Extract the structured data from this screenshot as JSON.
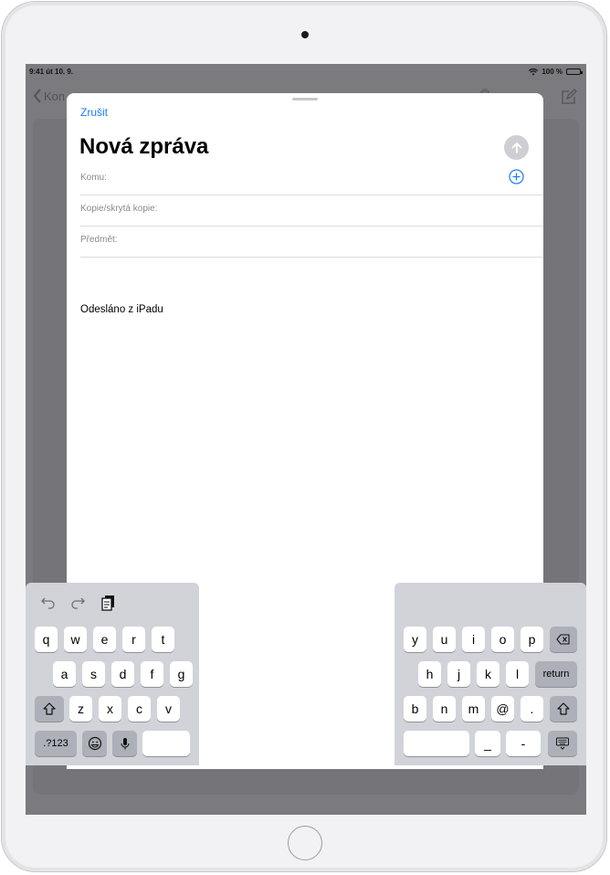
{
  "status_bar": {
    "time": "9:41 út 10. 9.",
    "battery": "100 %"
  },
  "background_mail": {
    "back_label": "Kon"
  },
  "compose": {
    "cancel_label": "Zrušit",
    "title": "Nová zpráva",
    "fields": {
      "to_label": "Komu:",
      "cc_bcc_label": "Kopie/skrytá kopie:",
      "subject_label": "Předmět:"
    },
    "signature": "Odesláno z iPadu"
  },
  "keyboard": {
    "left": {
      "row1": [
        "q",
        "w",
        "e",
        "r",
        "t"
      ],
      "row2": [
        "a",
        "s",
        "d",
        "f",
        "g"
      ],
      "row3": [
        "z",
        "x",
        "c",
        "v"
      ],
      "numbers_label": ".?123"
    },
    "right": {
      "row1": [
        "y",
        "u",
        "i",
        "o",
        "p"
      ],
      "row2": [
        "h",
        "j",
        "k",
        "l"
      ],
      "return_label": "return",
      "row3": [
        "b",
        "n",
        "m",
        "@",
        "."
      ],
      "row4": [
        "_",
        "-"
      ]
    }
  },
  "colors": {
    "accent": "#1a7cf4",
    "keyboard_bg": "#d1d3d9",
    "modifier_key": "#adb0b8",
    "dim_background": "#7b7b7f"
  },
  "icons": [
    "wifi-icon",
    "battery-icon",
    "chevron-left-icon",
    "trash-icon",
    "compose-icon",
    "send-arrow-icon",
    "add-contact-icon",
    "undo-icon",
    "redo-icon",
    "paste-icon",
    "shift-icon",
    "emoji-icon",
    "microphone-icon",
    "delete-icon",
    "keyboard-dismiss-icon"
  ]
}
